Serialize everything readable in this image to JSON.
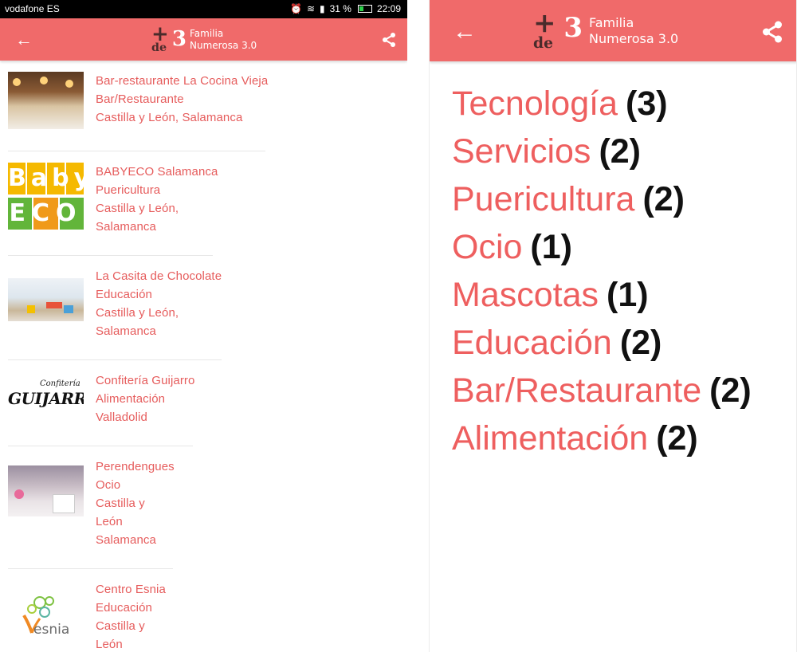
{
  "status": {
    "carrier": "vodafone ES",
    "battery": "31 %",
    "time": "22:09"
  },
  "brand": {
    "logo_plus": "+",
    "logo_de": "de",
    "logo_number": "3",
    "name_line1": "Familia",
    "name_line2": "Numerosa 3.0",
    "primary_color": "#f06a6a",
    "link_color": "#e65c5c"
  },
  "left": {
    "back_icon": "←",
    "items": [
      {
        "name": "Bar-restaurante La Cocina Vieja",
        "category": "Bar/Restaurante",
        "region": "Castilla y León",
        "city": "Salamanca",
        "thumb": "restaurant-photo"
      },
      {
        "name": "BABYECO Salamanca",
        "category": "Puericultura",
        "region": "Castilla y León",
        "city": "Salamanca",
        "thumb": "babyeco-logo"
      },
      {
        "name": "La Casita de Chocolate",
        "category": "Educación",
        "region": "Castilla y León",
        "city": "Salamanca",
        "thumb": "classroom-photo"
      },
      {
        "name": "Confitería Guijarro",
        "category": "Alimentación",
        "region": "",
        "city": "Valladolid",
        "thumb": "guijarro-logo"
      },
      {
        "name": "Perendengues",
        "category": "Ocio",
        "region": "Castilla y León",
        "city": "Salamanca",
        "thumb": "playroom-photo"
      },
      {
        "name": "Centro Esnia",
        "category": "Educación",
        "region": "Castilla y León",
        "city": "",
        "thumb": "esnia-logo"
      }
    ],
    "babyeco_logo": {
      "line1": "Baby",
      "line2": "ECO"
    },
    "guijarro_logo": {
      "top": "Confitería",
      "main": "GUIJARRO"
    },
    "esnia_logo": {
      "text": "esnia"
    }
  },
  "right": {
    "back_icon": "←",
    "categories": [
      {
        "name": "Tecnología",
        "count": "(3)"
      },
      {
        "name": "Servicios",
        "count": "(2)"
      },
      {
        "name": "Puericultura",
        "count": "(2)"
      },
      {
        "name": "Ocio",
        "count": "(1)"
      },
      {
        "name": "Mascotas",
        "count": "(1)"
      },
      {
        "name": "Educación",
        "count": "(2)"
      },
      {
        "name": "Bar/Restaurante",
        "count": "(2)"
      },
      {
        "name": "Alimentación",
        "count": "(2)"
      }
    ]
  }
}
